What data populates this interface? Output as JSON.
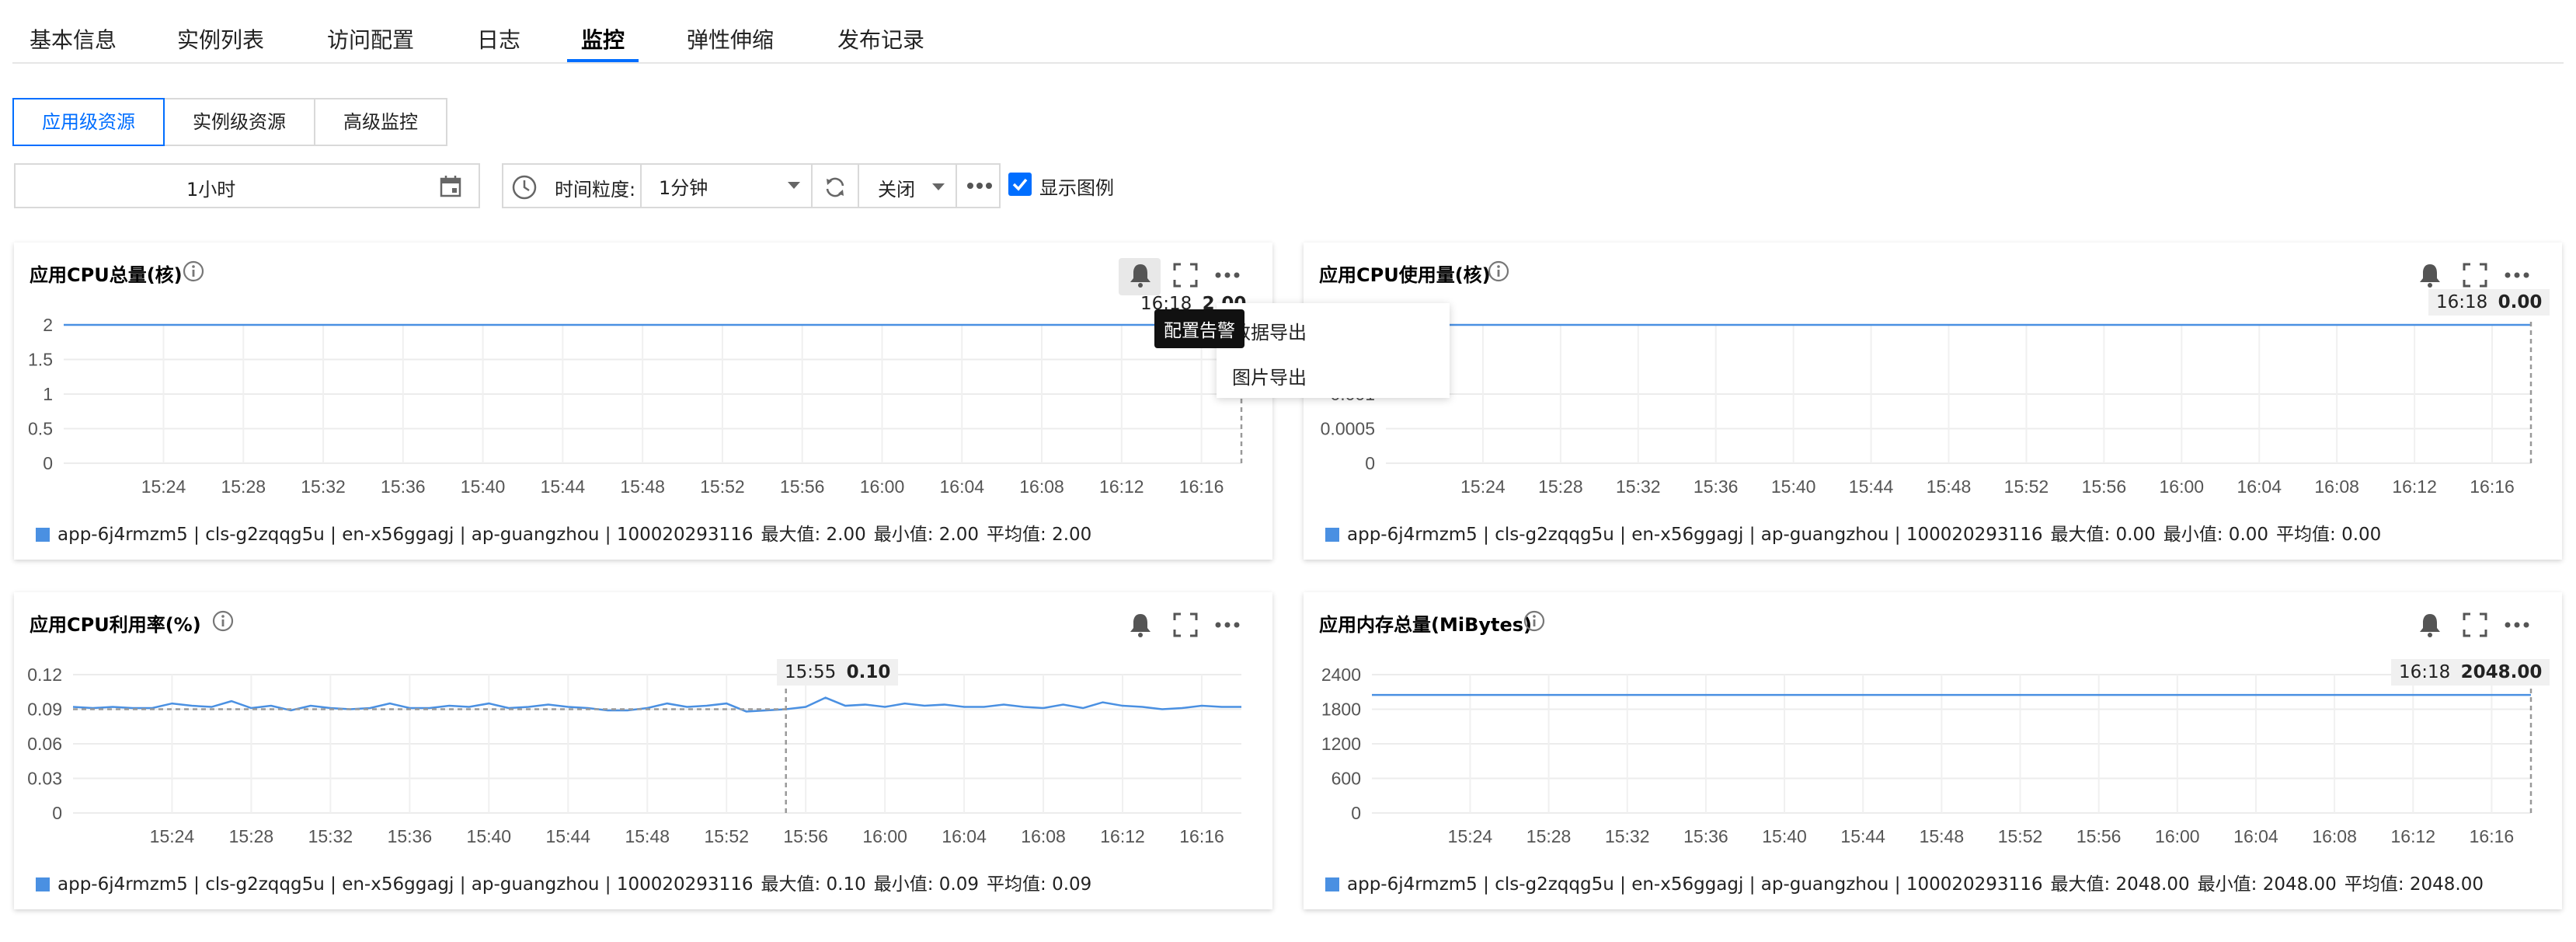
{
  "top_tabs": [
    "基本信息",
    "实例列表",
    "访问配置",
    "日志",
    "监控",
    "弹性伸缩",
    "发布记录"
  ],
  "active_top_tab": "监控",
  "sub_tabs": [
    "应用级资源",
    "实例级资源",
    "高级监控"
  ],
  "toolbar": {
    "time_range": "1小时",
    "granularity_label": "时间粒度:",
    "granularity_value": "1分钟",
    "refresh_value": "关闭",
    "show_legend_label": "显示图例",
    "show_legend_checked": true
  },
  "menu": {
    "items": [
      "数据导出",
      "图片导出"
    ],
    "hint": "配置告警"
  },
  "accent_color": "#006eff",
  "series_color": "#4a90e2",
  "panels": [
    {
      "title": "应用CPU总量(核)",
      "legend": "app-6j4rmzm5 | cls-g2zqqg5u | en-x56ggagj | ap-guangzhou | 100020293116",
      "stat_max": "最大值: 2.00",
      "stat_min": "最小值: 2.00",
      "stat_avg": "平均值: 2.00",
      "tooltip_time": "16:18",
      "tooltip_value": "2.00"
    },
    {
      "title": "应用CPU使用量(核)",
      "legend": "app-6j4rmzm5 | cls-g2zqqg5u | en-x56ggagj | ap-guangzhou | 100020293116",
      "stat_max": "最大值: 0.00",
      "stat_min": "最小值: 0.00",
      "stat_avg": "平均值: 0.00",
      "tooltip_time": "16:18",
      "tooltip_value": "0.00"
    },
    {
      "title": "应用CPU利用率(%)",
      "legend": "app-6j4rmzm5 | cls-g2zqqg5u | en-x56ggagj | ap-guangzhou | 100020293116",
      "stat_max": "最大值: 0.10",
      "stat_min": "最小值: 0.09",
      "stat_avg": "平均值: 0.09",
      "tooltip_time": "15:55",
      "tooltip_value": "0.10"
    },
    {
      "title": "应用内存总量(MiBytes)",
      "legend": "app-6j4rmzm5 | cls-g2zqqg5u | en-x56ggagj | ap-guangzhou | 100020293116",
      "stat_max": "最大值: 2048.00",
      "stat_min": "最小值: 2048.00",
      "stat_avg": "平均值: 2048.00",
      "tooltip_time": "16:18",
      "tooltip_value": "2048.00"
    }
  ],
  "chart_data": [
    {
      "type": "line",
      "title": "应用CPU总量(核)",
      "x_ticks": [
        "15:24",
        "15:28",
        "15:32",
        "15:36",
        "15:40",
        "15:44",
        "15:48",
        "15:52",
        "15:56",
        "16:00",
        "16:04",
        "16:08",
        "16:12",
        "16:16"
      ],
      "y_ticks": [
        "0",
        "0.5",
        "1",
        "1.5",
        "2"
      ],
      "ylim": [
        0,
        2
      ],
      "x_range": [
        "15:19",
        "16:18"
      ],
      "series": [
        {
          "name": "app-6j4rmzm5 | cls-g2zqqg5u | en-x56ggagj | ap-guangzhou | 100020293116",
          "constant": 2
        }
      ],
      "crosshair_x": "16:18",
      "grid": true
    },
    {
      "type": "line",
      "title": "应用CPU使用量(核)",
      "x_ticks": [
        "15:24",
        "15:28",
        "15:32",
        "15:36",
        "15:40",
        "15:44",
        "15:48",
        "15:52",
        "15:56",
        "16:00",
        "16:04",
        "16:08",
        "16:12",
        "16:16"
      ],
      "y_ticks": [
        "0",
        "0.0005",
        "0.001"
      ],
      "ylim": [
        0,
        0.002
      ],
      "x_range": [
        "15:19",
        "16:18"
      ],
      "series": [
        {
          "name": "app-6j4rmzm5 | cls-g2zqqg5u | en-x56ggagj | ap-guangzhou | 100020293116",
          "constant": 0.002
        }
      ],
      "crosshair_x": "16:18",
      "grid": true
    },
    {
      "type": "line",
      "title": "应用CPU利用率(%)",
      "x_ticks": [
        "15:24",
        "15:28",
        "15:32",
        "15:36",
        "15:40",
        "15:44",
        "15:48",
        "15:52",
        "15:56",
        "16:00",
        "16:04",
        "16:08",
        "16:12",
        "16:16"
      ],
      "y_ticks": [
        "0",
        "0.03",
        "0.06",
        "0.09",
        "0.12"
      ],
      "ylim": [
        0,
        0.12
      ],
      "x_range": [
        "15:19",
        "16:18"
      ],
      "series": [
        {
          "name": "app-6j4rmzm5 | cls-g2zqqg5u | en-x56ggagj | ap-guangzhou | 100020293116",
          "values": [
            0.092,
            0.091,
            0.092,
            0.091,
            0.091,
            0.095,
            0.093,
            0.092,
            0.097,
            0.091,
            0.093,
            0.089,
            0.093,
            0.091,
            0.09,
            0.091,
            0.095,
            0.091,
            0.091,
            0.093,
            0.092,
            0.095,
            0.091,
            0.092,
            0.094,
            0.092,
            0.091,
            0.089,
            0.089,
            0.091,
            0.095,
            0.092,
            0.093,
            0.095,
            0.088,
            0.089,
            0.09,
            0.092,
            0.1,
            0.093,
            0.094,
            0.092,
            0.095,
            0.093,
            0.094,
            0.092,
            0.092,
            0.094,
            0.092,
            0.091,
            0.094,
            0.091,
            0.096,
            0.093,
            0.092,
            0.09,
            0.091,
            0.093,
            0.092,
            0.092
          ]
        }
      ],
      "crosshair_x": "15:55",
      "grid": true
    },
    {
      "type": "line",
      "title": "应用内存总量(MiBytes)",
      "x_ticks": [
        "15:24",
        "15:28",
        "15:32",
        "15:36",
        "15:40",
        "15:44",
        "15:48",
        "15:52",
        "15:56",
        "16:00",
        "16:04",
        "16:08",
        "16:12",
        "16:16"
      ],
      "y_ticks": [
        "0",
        "600",
        "1200",
        "1800",
        "2400"
      ],
      "ylim": [
        0,
        2400
      ],
      "x_range": [
        "15:19",
        "16:18"
      ],
      "series": [
        {
          "name": "app-6j4rmzm5 | cls-g2zqqg5u | en-x56ggagj | ap-guangzhou | 100020293116",
          "constant": 2048
        }
      ],
      "crosshair_x": "16:18",
      "grid": true
    }
  ]
}
